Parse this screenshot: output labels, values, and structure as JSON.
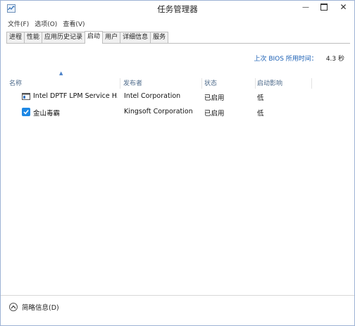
{
  "window": {
    "title": "任务管理器"
  },
  "menu": [
    "文件(F)",
    "选项(O)",
    "查看(V)"
  ],
  "tabs": [
    {
      "label": "进程",
      "active": false
    },
    {
      "label": "性能",
      "active": false
    },
    {
      "label": "应用历史记录",
      "active": false
    },
    {
      "label": "启动",
      "active": true
    },
    {
      "label": "用户",
      "active": false
    },
    {
      "label": "详细信息",
      "active": false
    },
    {
      "label": "服务",
      "active": false
    }
  ],
  "boot": {
    "label": "上次 BIOS 所用时间：",
    "value": "4.3 秒"
  },
  "columns": {
    "name": "名称",
    "publisher": "发布者",
    "status": "状态",
    "impact": "启动影响"
  },
  "rows": [
    {
      "icon": "app-window-icon",
      "name": "Intel DPTF LPM Service H...",
      "publisher": "Intel Corporation",
      "status": "已启用",
      "impact": "低"
    },
    {
      "icon": "kingsoft-antivirus-icon",
      "name": "金山毒霸",
      "publisher": "Kingsoft Corporation",
      "status": "已启用",
      "impact": "低"
    }
  ],
  "footer": {
    "label": "简略信息(D)"
  },
  "colors": {
    "accent": "#1a5fb4",
    "header_text": "#4d6a8a"
  }
}
